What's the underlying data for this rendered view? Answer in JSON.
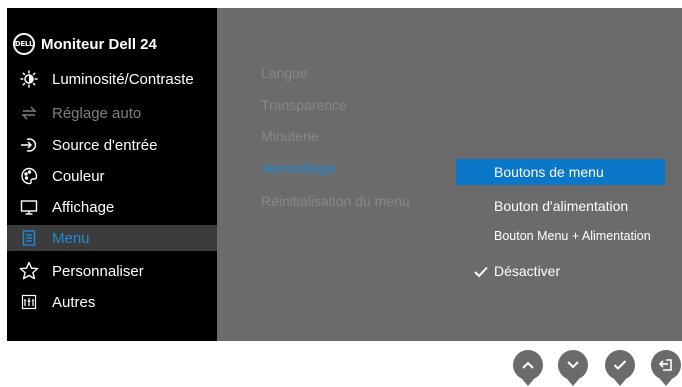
{
  "header": {
    "logo_text": "DELL",
    "title": "Moniteur Dell 24"
  },
  "sidebar": {
    "items": [
      {
        "label": "Luminosité/Contraste",
        "icon": "brightness-icon"
      },
      {
        "label": "Réglage auto",
        "icon": "auto-adjust-icon",
        "state": "disabled"
      },
      {
        "label": "Source d'entrée",
        "icon": "input-source-icon"
      },
      {
        "label": "Couleur",
        "icon": "color-icon"
      },
      {
        "label": "Affichage",
        "icon": "display-icon"
      },
      {
        "label": "Menu",
        "icon": "menu-icon",
        "state": "selected"
      },
      {
        "label": "Personnaliser",
        "icon": "star-icon"
      },
      {
        "label": "Autres",
        "icon": "others-icon"
      }
    ]
  },
  "submenu": {
    "items": [
      {
        "label": "Langue"
      },
      {
        "label": "Transparence"
      },
      {
        "label": "Minuterie"
      },
      {
        "label": "Verrouillage",
        "state": "active"
      },
      {
        "label": "Réinitialisation du menu"
      }
    ]
  },
  "options": {
    "items": [
      {
        "label": "Boutons de menu",
        "state": "highlighted"
      },
      {
        "label": "Bouton d'alimentation"
      },
      {
        "label": "Bouton Menu + Alimentation"
      },
      {
        "label": "Désactiver",
        "state": "checked"
      }
    ]
  },
  "buttons": [
    {
      "name": "up-button",
      "icon": "chevron-up-icon"
    },
    {
      "name": "down-button",
      "icon": "chevron-down-icon"
    },
    {
      "name": "ok-button",
      "icon": "checkmark-icon"
    },
    {
      "name": "back-button",
      "icon": "back-arrow-icon"
    }
  ],
  "colors": {
    "accent": "#1e8ad8",
    "highlight": "#0a77c8",
    "sidebar_bg": "#000000",
    "main_bg": "#6b6b6b",
    "selected_row": "#3c3c3c",
    "disabled_text": "#7f7f7f",
    "inactive_submenu": "#888888"
  }
}
